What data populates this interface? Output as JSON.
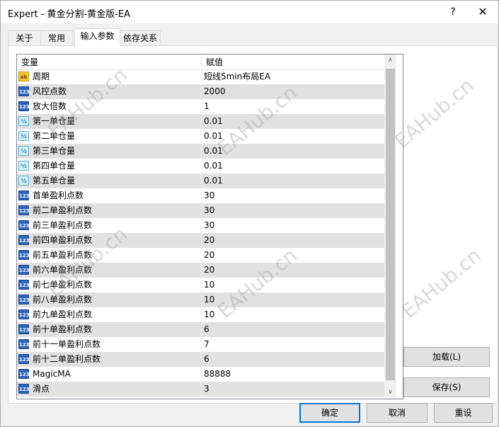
{
  "window": {
    "title": "Expert - 黄金分割-黄金版-EA",
    "help_glyph": "?",
    "close_glyph": "✕"
  },
  "tabs": [
    {
      "label": "关于",
      "active": false
    },
    {
      "label": "常用",
      "active": false
    },
    {
      "label": "输入参数",
      "active": true
    },
    {
      "label": "依存关系",
      "active": false
    }
  ],
  "table": {
    "headers": {
      "variable": "变量",
      "value": "赋值"
    },
    "rows": [
      {
        "icon": "ab",
        "name": "周期",
        "value": "短线5min布局EA"
      },
      {
        "icon": "123",
        "name": "风控点数",
        "value": "2000"
      },
      {
        "icon": "123",
        "name": "放大倍数",
        "value": "1"
      },
      {
        "icon": "frac",
        "name": "第一单仓量",
        "value": "0.01"
      },
      {
        "icon": "frac",
        "name": "第二单仓量",
        "value": "0.01"
      },
      {
        "icon": "frac",
        "name": "第三单仓量",
        "value": "0.01"
      },
      {
        "icon": "frac",
        "name": "第四单仓量",
        "value": "0.01"
      },
      {
        "icon": "frac",
        "name": "第五单仓量",
        "value": "0.01"
      },
      {
        "icon": "123",
        "name": "首单盈利点数",
        "value": "30"
      },
      {
        "icon": "123",
        "name": "前二单盈利点数",
        "value": "30"
      },
      {
        "icon": "123",
        "name": "前三单盈利点数",
        "value": "30"
      },
      {
        "icon": "123",
        "name": "前四单盈利点数",
        "value": "20"
      },
      {
        "icon": "123",
        "name": "前五单盈利点数",
        "value": "20"
      },
      {
        "icon": "123",
        "name": "前六单盈利点数",
        "value": "20"
      },
      {
        "icon": "123",
        "name": "前七单盈利点数",
        "value": "10"
      },
      {
        "icon": "123",
        "name": "前八单盈利点数",
        "value": "10"
      },
      {
        "icon": "123",
        "name": "前九单盈利点数",
        "value": "10"
      },
      {
        "icon": "123",
        "name": "前十单盈利点数",
        "value": "6"
      },
      {
        "icon": "123",
        "name": "前十一单盈利点数",
        "value": "7"
      },
      {
        "icon": "123",
        "name": "前十二单盈利点数",
        "value": "6"
      },
      {
        "icon": "123",
        "name": "MagicMA",
        "value": "88888"
      },
      {
        "icon": "123",
        "name": "滑点",
        "value": "3"
      }
    ]
  },
  "icon_labels": {
    "ab": "ab",
    "n123": "123",
    "frac": "½"
  },
  "scroll": {
    "up_glyph": "∧",
    "down_glyph": "∨"
  },
  "buttons": {
    "load": "加载(L)",
    "save": "保存(S)",
    "ok": "确定",
    "cancel": "取消",
    "reset": "重设"
  },
  "watermark": "EAHub.cn",
  "colors": {
    "accent": "#0078d7",
    "alt_row": "#e1e1e1"
  }
}
